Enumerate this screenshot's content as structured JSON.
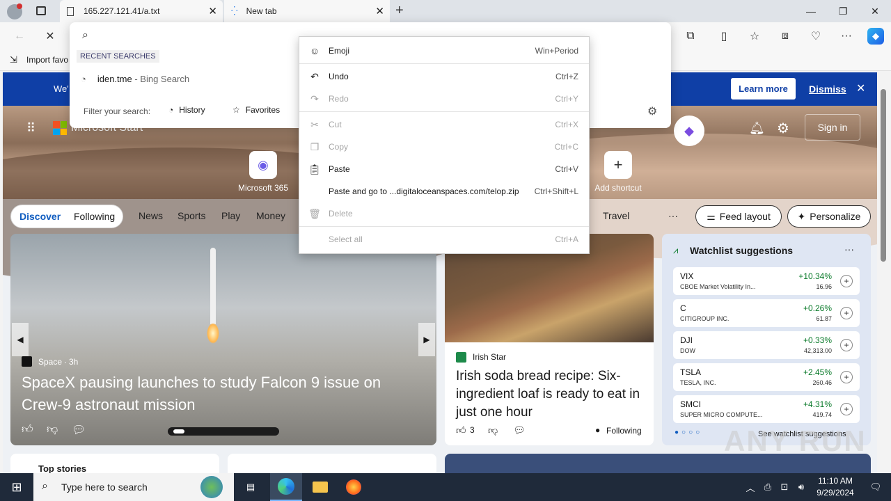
{
  "tabs": [
    {
      "title": "165.227.121.41/a.txt"
    },
    {
      "title": "New tab"
    }
  ],
  "favorites_bar": {
    "import_label": "Import favo"
  },
  "address_dropdown": {
    "recent_label": "RECENT SEARCHES",
    "recent_item": {
      "query": "iden.tme",
      "suffix": " - Bing Search"
    },
    "filter_label": "Filter your search:",
    "filters": [
      "History",
      "Favorites"
    ]
  },
  "context_menu": {
    "items": [
      {
        "label": "Emoji",
        "shortcut": "Win+Period",
        "icon": "emoji-icon",
        "disabled": false
      },
      {
        "label": "Undo",
        "shortcut": "Ctrl+Z",
        "icon": "undo-icon",
        "disabled": false
      },
      {
        "label": "Redo",
        "shortcut": "Ctrl+Y",
        "icon": "redo-icon",
        "disabled": true
      },
      {
        "label": "Cut",
        "shortcut": "Ctrl+X",
        "icon": "cut-icon",
        "disabled": true
      },
      {
        "label": "Copy",
        "shortcut": "Ctrl+C",
        "icon": "copy-icon",
        "disabled": true
      },
      {
        "label": "Paste",
        "shortcut": "Ctrl+V",
        "icon": "paste-icon",
        "disabled": false
      },
      {
        "label": "Paste and go to ...digitaloceanspaces.com/telop.zip",
        "shortcut": "Ctrl+Shift+L",
        "icon": "",
        "disabled": false
      },
      {
        "label": "Delete",
        "shortcut": "",
        "icon": "delete-icon",
        "disabled": true
      },
      {
        "label": "Select all",
        "shortcut": "Ctrl+A",
        "icon": "",
        "disabled": true
      }
    ]
  },
  "banner": {
    "text": "We'",
    "learn_more": "Learn more",
    "dismiss": "Dismiss"
  },
  "msstart": {
    "brand": "Microsoft Start",
    "sign_in": "Sign in",
    "shortcuts": [
      "Microsoft 365",
      "Add shortcut"
    ]
  },
  "feed_nav": {
    "discover": "Discover",
    "following": "Following",
    "items": [
      "News",
      "Sports",
      "Play",
      "Money"
    ],
    "travel": "Travel",
    "more": "···",
    "feed_layout": "Feed layout",
    "personalize": "Personalize"
  },
  "main_story": {
    "source": "Space",
    "age": "3h",
    "headline": "SpaceX pausing launches to study Falcon 9 issue on Crew-9 astronaut mission"
  },
  "story2": {
    "source": "Irish Star",
    "headline": "Irish soda bread recipe: Six-ingredient loaf is ready to eat in just one hour",
    "likes": "3",
    "following": "Following"
  },
  "watchlist": {
    "title": "Watchlist suggestions",
    "stocks": [
      {
        "symbol": "VIX",
        "name": "CBOE Market Volatility In...",
        "change": "+10.34%",
        "price": "16.96"
      },
      {
        "symbol": "C",
        "name": "CITIGROUP INC.",
        "change": "+0.26%",
        "price": "61.87"
      },
      {
        "symbol": "DJI",
        "name": "DOW",
        "change": "+0.33%",
        "price": "42,313.00"
      },
      {
        "symbol": "TSLA",
        "name": "TESLA, INC.",
        "change": "+2.45%",
        "price": "260.46"
      },
      {
        "symbol": "SMCI",
        "name": "SUPER MICRO COMPUTE...",
        "change": "+4.31%",
        "price": "419.74"
      }
    ],
    "see_more": "See watchlist suggestions"
  },
  "top_stories": "Top stories",
  "taskbar": {
    "search_placeholder": "Type here to search",
    "time": "11:10 AM",
    "date": "9/29/2024"
  },
  "watermark": "ANY RUN"
}
